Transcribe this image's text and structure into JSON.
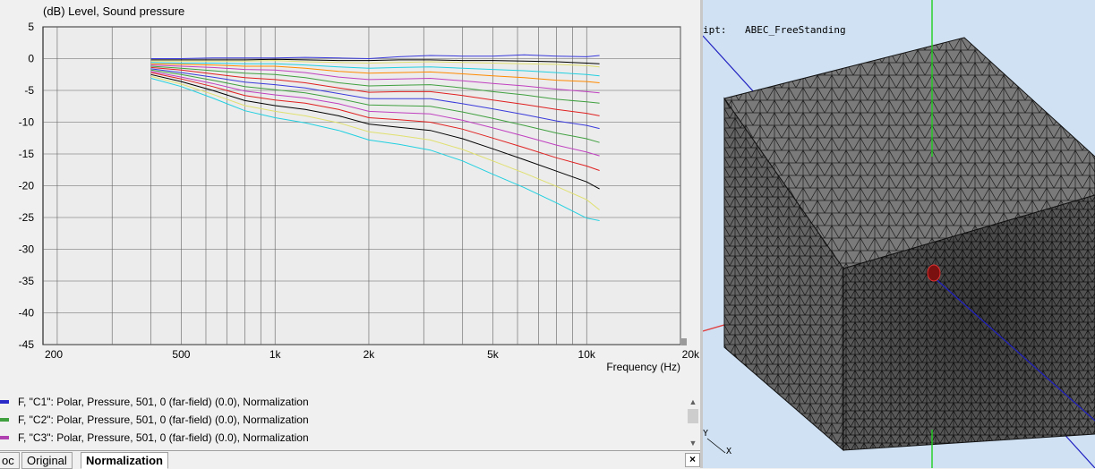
{
  "chart_data": {
    "type": "line",
    "ylabel_unit": "(dB)",
    "ylabel": "Level, Sound pressure",
    "xlabel": "Frequency  (Hz)",
    "xscale": "log",
    "xlim": [
      180,
      20000
    ],
    "ylim": [
      -45,
      5
    ],
    "yticks": [
      5,
      0,
      -5,
      -10,
      -15,
      -20,
      -25,
      -30,
      -35,
      -40,
      -45
    ],
    "xticks": [
      {
        "value": 200,
        "label": "200"
      },
      {
        "value": 500,
        "label": "500"
      },
      {
        "value": 1000,
        "label": "1k"
      },
      {
        "value": 2000,
        "label": "2k"
      },
      {
        "value": 5000,
        "label": "5k"
      },
      {
        "value": 10000,
        "label": "10k"
      },
      {
        "value": 20000,
        "label": "20k"
      }
    ],
    "grid": true,
    "x": [
      400,
      500,
      630,
      800,
      1000,
      1250,
      1600,
      2000,
      2500,
      3150,
      4000,
      5000,
      6300,
      8000,
      10000,
      11000
    ],
    "series": [
      {
        "color": "#3a3adc",
        "values": [
          0.0,
          0.0,
          0.1,
          0.1,
          0.1,
          0.2,
          0.1,
          0.0,
          0.3,
          0.5,
          0.4,
          0.4,
          0.6,
          0.4,
          0.3,
          0.5
        ]
      },
      {
        "color": "#000000",
        "values": [
          -0.2,
          -0.2,
          -0.2,
          -0.2,
          -0.1,
          -0.2,
          -0.3,
          -0.3,
          -0.2,
          -0.2,
          -0.3,
          -0.3,
          -0.4,
          -0.5,
          -0.7,
          -0.8
        ]
      },
      {
        "color": "#e0e070",
        "values": [
          -0.4,
          -0.4,
          -0.4,
          -0.4,
          -0.3,
          -0.5,
          -0.6,
          -0.7,
          -0.6,
          -0.5,
          -0.6,
          -0.7,
          -0.8,
          -0.9,
          -1.1,
          -1.3
        ]
      },
      {
        "color": "#22d0e0",
        "values": [
          -0.6,
          -0.7,
          -0.7,
          -0.8,
          -0.8,
          -1.0,
          -1.3,
          -1.5,
          -1.4,
          -1.3,
          -1.5,
          -1.7,
          -1.9,
          -2.2,
          -2.5,
          -2.7
        ]
      },
      {
        "color": "#ff8a00",
        "values": [
          -0.8,
          -0.9,
          -1.0,
          -1.2,
          -1.2,
          -1.5,
          -2.0,
          -2.3,
          -2.2,
          -2.1,
          -2.4,
          -2.7,
          -3.0,
          -3.4,
          -3.6,
          -3.8
        ]
      },
      {
        "color": "#c040c0",
        "values": [
          -1.0,
          -1.2,
          -1.4,
          -1.7,
          -1.8,
          -2.2,
          -2.9,
          -3.3,
          -3.2,
          -3.1,
          -3.5,
          -3.9,
          -4.3,
          -4.8,
          -5.2,
          -5.4
        ]
      },
      {
        "color": "#40a040",
        "values": [
          -1.2,
          -1.5,
          -1.9,
          -2.3,
          -2.5,
          -3.0,
          -3.8,
          -4.3,
          -4.2,
          -4.1,
          -4.6,
          -5.2,
          -5.7,
          -6.4,
          -6.8,
          -7.0
        ]
      },
      {
        "color": "#e02020",
        "values": [
          -1.4,
          -1.8,
          -2.4,
          -3.0,
          -3.3,
          -3.8,
          -4.6,
          -5.3,
          -5.2,
          -5.2,
          -5.8,
          -6.5,
          -7.2,
          -8.0,
          -8.6,
          -9.0
        ]
      },
      {
        "color": "#3a3adc",
        "values": [
          -1.6,
          -2.2,
          -2.9,
          -3.7,
          -4.1,
          -4.6,
          -5.5,
          -6.3,
          -6.3,
          -6.3,
          -7.1,
          -7.9,
          -8.8,
          -9.8,
          -10.5,
          -11.0
        ]
      },
      {
        "color": "#40a040",
        "values": [
          -1.8,
          -2.5,
          -3.4,
          -4.4,
          -4.9,
          -5.4,
          -6.3,
          -7.3,
          -7.4,
          -7.5,
          -8.4,
          -9.4,
          -10.5,
          -11.7,
          -12.6,
          -13.2
        ]
      },
      {
        "color": "#c040c0",
        "values": [
          -2.0,
          -2.9,
          -3.9,
          -5.1,
          -5.7,
          -6.2,
          -7.1,
          -8.3,
          -8.5,
          -8.7,
          -9.7,
          -10.9,
          -12.2,
          -13.6,
          -14.7,
          -15.3
        ]
      },
      {
        "color": "#e02020",
        "values": [
          -2.2,
          -3.2,
          -4.4,
          -5.8,
          -6.5,
          -7.0,
          -8.0,
          -9.3,
          -9.6,
          -10.0,
          -11.1,
          -12.5,
          -14.0,
          -15.6,
          -16.9,
          -17.6
        ]
      },
      {
        "color": "#000000",
        "values": [
          -2.5,
          -3.6,
          -5.0,
          -6.6,
          -7.4,
          -8.0,
          -9.0,
          -10.3,
          -10.8,
          -11.3,
          -12.6,
          -14.2,
          -15.9,
          -17.7,
          -19.4,
          -20.5
        ]
      },
      {
        "color": "#e0e070",
        "values": [
          -2.8,
          -4.0,
          -5.6,
          -7.4,
          -8.3,
          -9.0,
          -10.1,
          -11.5,
          -12.1,
          -12.8,
          -14.3,
          -16.1,
          -18.0,
          -20.1,
          -22.2,
          -23.8
        ]
      },
      {
        "color": "#22d0e0",
        "values": [
          -3.1,
          -4.4,
          -6.2,
          -8.2,
          -9.3,
          -10.1,
          -11.3,
          -12.8,
          -13.5,
          -14.4,
          -16.1,
          -18.2,
          -20.3,
          -22.7,
          -25.1,
          -25.5
        ]
      }
    ]
  },
  "legend": [
    {
      "label": "F, \"C1\": Polar, Pressure, 501, 0 (far-field) (0.0), Normalization",
      "color": "#2a2ac8"
    },
    {
      "label": "F, \"C2\": Polar, Pressure, 501, 0 (far-field) (0.0), Normalization",
      "color": "#40a040"
    },
    {
      "label": "F, \"C3\": Polar, Pressure, 501, 0 (far-field) (0.0), Normalization",
      "color": "#b040b0"
    }
  ],
  "tabs": [
    {
      "label": "oc",
      "active": false
    },
    {
      "label": "Original",
      "active": false
    },
    {
      "label": "Normalization",
      "active": true
    }
  ],
  "close_label": "×",
  "scroll_up": "▲",
  "scroll_down": "▼",
  "scene": {
    "script_label": "ipt:",
    "script_name": "ABEC_FreeStanding",
    "axis_y": "Y",
    "axis_x": "X",
    "background": "#cfe1f3"
  }
}
